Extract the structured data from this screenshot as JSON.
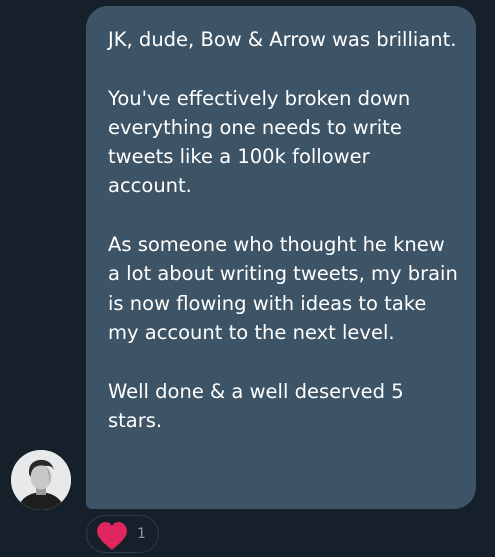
{
  "message": {
    "paragraphs": [
      "JK, dude, Bow & Arrow was brilliant.",
      "You've effectively broken down everything one needs to write tweets like a 100k follower account.",
      "As someone who thought he knew a lot about writing tweets, my brain is now flowing with ideas to take my account to the next level.",
      "Well done & a well deserved 5 stars."
    ]
  },
  "reaction": {
    "icon": "heart-icon",
    "count": "1",
    "color": "#e0245e"
  },
  "colors": {
    "background": "#15202b",
    "bubble": "#3d5466",
    "text": "#ffffff"
  }
}
